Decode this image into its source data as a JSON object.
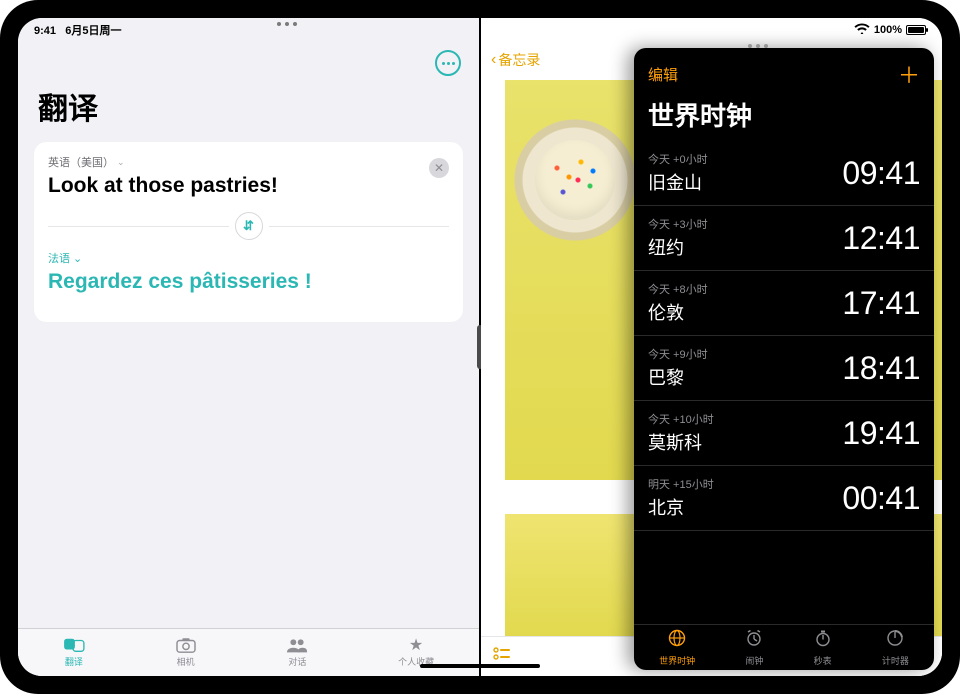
{
  "status": {
    "time": "9:41",
    "date": "6月5日周一",
    "battery_pct": "100%"
  },
  "translate": {
    "app_title": "翻译",
    "source_lang": "英语（美国）",
    "source_text": "Look at those pastries!",
    "target_lang": "法语",
    "target_text": "Regardez ces pâtisseries !",
    "tabs": [
      {
        "label": "翻译",
        "icon": "translate-icon"
      },
      {
        "label": "相机",
        "icon": "camera-icon"
      },
      {
        "label": "对话",
        "icon": "people-icon"
      },
      {
        "label": "个人收藏",
        "icon": "star-icon"
      }
    ]
  },
  "notes": {
    "back_label": "备忘录"
  },
  "clock": {
    "edit_label": "编辑",
    "title": "世界时钟",
    "cities": [
      {
        "offset": "今天 +0小时",
        "name": "旧金山",
        "time": "09:41"
      },
      {
        "offset": "今天 +3小时",
        "name": "纽约",
        "time": "12:41"
      },
      {
        "offset": "今天 +8小时",
        "name": "伦敦",
        "time": "17:41"
      },
      {
        "offset": "今天 +9小时",
        "name": "巴黎",
        "time": "18:41"
      },
      {
        "offset": "今天 +10小时",
        "name": "莫斯科",
        "time": "19:41"
      },
      {
        "offset": "明天 +15小时",
        "name": "北京",
        "time": "00:41"
      }
    ],
    "tabs": [
      {
        "label": "世界时钟",
        "icon": "globe-icon"
      },
      {
        "label": "闹钟",
        "icon": "alarm-icon"
      },
      {
        "label": "秒表",
        "icon": "stopwatch-icon"
      },
      {
        "label": "计时器",
        "icon": "timer-icon"
      }
    ]
  }
}
